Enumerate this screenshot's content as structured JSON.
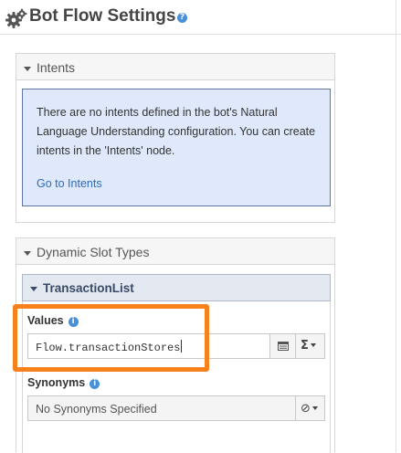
{
  "header": {
    "title": "Bot Flow Settings",
    "icons": [
      "gears-icon",
      "help-icon"
    ],
    "help_glyph": "?"
  },
  "intents": {
    "title": "Intents",
    "message": "There are no intents defined in the bot's Natural Language Understanding configuration. You can create intents in the 'Intents' node.",
    "link": "Go to Intents"
  },
  "dynamic_slot_types": {
    "title": "Dynamic Slot Types",
    "slot": {
      "name": "TransactionList",
      "values_label": "Values",
      "values_value": "Flow.transactionStores",
      "values_buttons": [
        "list-icon",
        "sigma-dropdown-icon"
      ],
      "sigma_glyph": "Σ",
      "synonyms_label": "Synonyms",
      "synonyms_value": "No Synonyms Specified",
      "synonyms_button": "clear-dropdown-icon",
      "clear_glyph": "⊘",
      "info_glyph": "i"
    }
  },
  "colors": {
    "highlight": "#f7821b",
    "info_message_bg": "#dfe9fb",
    "link": "#2c6cb8",
    "icon_blue": "#4a90d9"
  }
}
